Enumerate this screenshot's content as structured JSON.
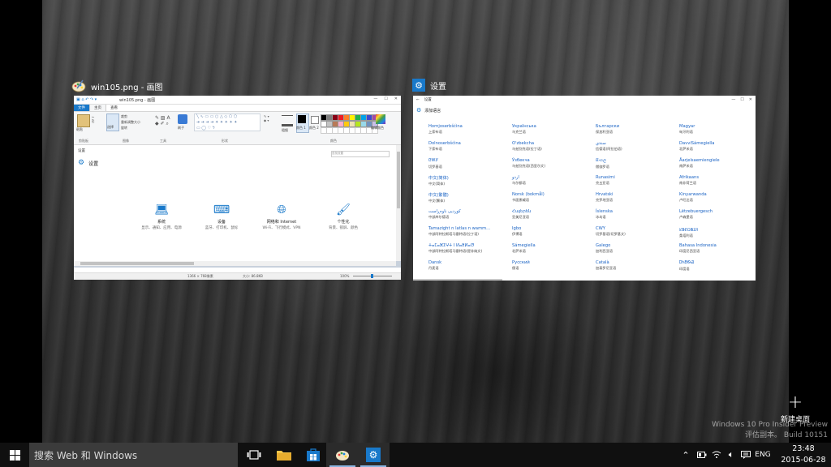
{
  "paint": {
    "title": "win105.png - 画图",
    "inner_title": "win105.png - 画图",
    "tabs": [
      "文件",
      "主页",
      "查看"
    ],
    "ribbon": {
      "paste": "粘贴",
      "select": "选择",
      "crop": "裁剪",
      "resize": "重新调整大小",
      "rotate": "旋转",
      "brush": "刷子",
      "size": "粗细",
      "color1": "颜色 1",
      "color2": "颜色 2",
      "edit_colors": "编辑颜色",
      "groups": [
        "剪贴板",
        "图像",
        "工具",
        "形状",
        "颜色"
      ]
    },
    "palette": [
      "#000000",
      "#7f7f7f",
      "#880015",
      "#ed1c24",
      "#ff7f27",
      "#fff200",
      "#22b14c",
      "#00a2e8",
      "#3f48cc",
      "#a349a4",
      "#ffffff",
      "#c3c3c3",
      "#b97a57",
      "#ffaec9",
      "#ffc90e",
      "#efe4b0",
      "#b5e61d",
      "#99d9ea",
      "#7092be",
      "#c8bfe7"
    ],
    "canvas": {
      "header": "设置",
      "title": "设置",
      "items": [
        {
          "title": "系统",
          "sub": "显示、通知、应用、电源"
        },
        {
          "title": "设备",
          "sub": "蓝牙、打印机、鼠标"
        },
        {
          "title": "网络和 Internet",
          "sub": "Wi-Fi、飞行模式、VPN"
        },
        {
          "title": "个性化",
          "sub": "背景、锁屏、颜色"
        }
      ],
      "search_hint": "查找设置"
    },
    "status": {
      "dimensions": "1366 × 768像素",
      "size": "大小: 86.8KB",
      "zoom": "100%"
    }
  },
  "settings": {
    "title": "设置",
    "inner_title": "设置",
    "section": "添加语言",
    "languages": [
      [
        {
          "name": "Hornjoserbšćina",
          "cn": "上索布语"
        },
        {
          "name": "Dolnoserbšćina",
          "cn": "下索布语"
        },
        {
          "name": "ᏣᎳᎩ",
          "cn": "切罗基语"
        },
        {
          "name": "中文(简体)",
          "cn": "中文(简体)"
        },
        {
          "name": "中文(繁體)",
          "cn": "中文(繁体)"
        },
        {
          "name": "کوردیی ناوەڕاست",
          "cn": "中部库尔德语"
        },
        {
          "name": "Tamazight n latlas n wamm...",
          "cn": "中部阿特拉斯塔马塞特语(拉丁语)"
        },
        {
          "name": "ⵜⴰⵎⴰⵣⵉⵖⵜ ⵏ ⵍⴰⵟⵍⴰⵚ",
          "cn": "中部阿特拉斯塔马塞特语(提非纳文)"
        },
        {
          "name": "Dansk",
          "cn": "丹麦语"
        }
      ],
      [
        {
          "name": "Українська",
          "cn": "乌克兰语"
        },
        {
          "name": "O'zbekcha",
          "cn": "乌兹别克语(拉丁语)"
        },
        {
          "name": "Ўзбекча",
          "cn": "乌兹别克语(西里尔文)"
        },
        {
          "name": "اردو",
          "cn": "乌尔都语"
        },
        {
          "name": "Norsk (bokmål)",
          "cn": "书面挪威语"
        },
        {
          "name": "Հայերեն",
          "cn": "亚美尼亚语"
        },
        {
          "name": "Igbo",
          "cn": "伊博语"
        },
        {
          "name": "Sámegiella",
          "cn": "北萨米语"
        },
        {
          "name": "Русский",
          "cn": "俄语"
        }
      ],
      [
        {
          "name": "Български",
          "cn": "保加利亚语"
        },
        {
          "name": "سنڌي",
          "cn": "信德语(阿拉伯语)"
        },
        {
          "name": "සිංහල",
          "cn": "僧伽罗语"
        },
        {
          "name": "Runasimi",
          "cn": "克丘亚语"
        },
        {
          "name": "Hrvatski",
          "cn": "克罗地亚语"
        },
        {
          "name": "Íslenska",
          "cn": "冰岛语"
        },
        {
          "name": "CWY",
          "cn": "切罗基语(切罗基文)"
        },
        {
          "name": "Galego",
          "cn": "加利西亚语"
        },
        {
          "name": "Català",
          "cn": "加泰罗尼亚语"
        }
      ],
      [
        {
          "name": "Magyar",
          "cn": "匈牙利语"
        },
        {
          "name": "DavviSámegiella",
          "cn": "北萨米语"
        },
        {
          "name": "Åarjelsaemiengiele",
          "cn": "南萨米语"
        },
        {
          "name": "Afrikaans",
          "cn": "南非荷兰语"
        },
        {
          "name": "Kinyarwanda",
          "cn": "卢旺达语"
        },
        {
          "name": "Lëtzebuergesch",
          "cn": "卢森堡语"
        },
        {
          "name": "ᱥᱟᱱᱛᱟᱲᱤ",
          "cn": "桑塔利语"
        },
        {
          "name": "Bahasa Indonesia",
          "cn": "印度尼西亚语"
        },
        {
          "name": "ᎠᏂᏴᏫᏯ",
          "cn": "印度语"
        }
      ]
    ]
  },
  "new_desktop": {
    "label": "新建桌面"
  },
  "watermark": {
    "line1": "Windows 10 Pro Insider Preview",
    "line2": "评估副本。  Build 10151"
  },
  "taskbar": {
    "search_placeholder": "搜索 Web 和 Windows",
    "language": "ENG",
    "time": "23:48",
    "date": "2015-06-28",
    "accent": "#1979ca"
  }
}
